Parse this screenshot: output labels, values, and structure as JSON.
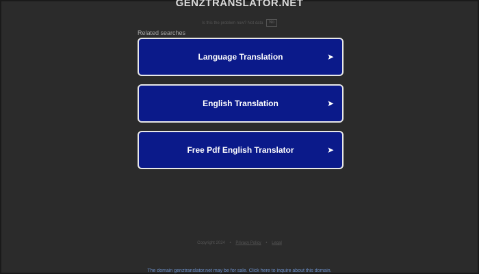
{
  "header": {
    "site_title": "GENZTRANSLATOR.NET"
  },
  "privacy": {
    "prompt": "Is this the problem now? Not data",
    "no_label": "No"
  },
  "related": {
    "label": "Related searches",
    "items": [
      {
        "label": "Language Translation",
        "icon": "arrow-right-icon"
      },
      {
        "label": "English Translation",
        "icon": "arrow-right-icon"
      },
      {
        "label": "Free Pdf English Translator",
        "icon": "arrow-right-icon"
      }
    ]
  },
  "footer": {
    "copyright": "Copyright 2024",
    "privacy_policy": "Privacy Policy",
    "legal": "Legal",
    "separator": "•"
  },
  "sale_banner": {
    "text": "The domain genztranslator.net may be for sale. Click here to inquire about this domain."
  },
  "colors": {
    "background": "#2b2b2b",
    "button_bg": "#0b1a8a",
    "button_border": "#e8e8e8",
    "banner_link": "#6b8fc9"
  }
}
